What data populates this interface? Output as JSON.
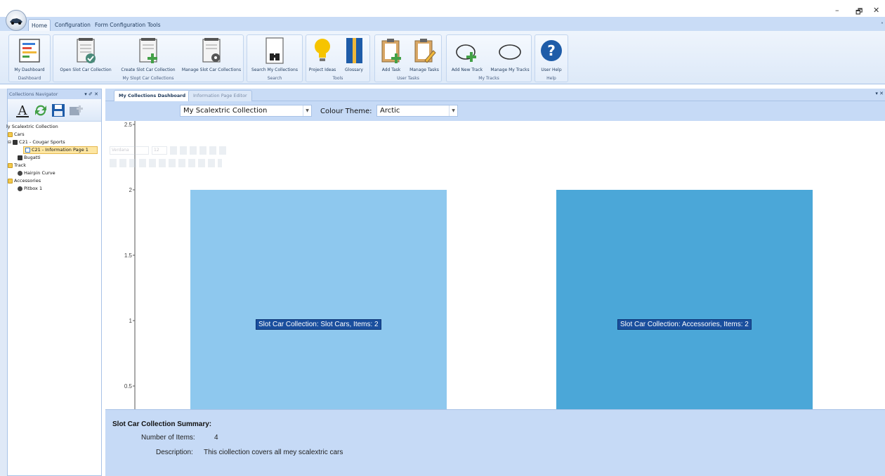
{
  "window": {
    "minimize": "–",
    "restore": "🗗",
    "close": "✕",
    "collapse": "˄"
  },
  "ribbon_tabs": [
    "Home",
    "Configuration",
    "Form Configuration",
    "Tools"
  ],
  "ribbon_groups": [
    {
      "label": "Dashboard",
      "buttons": [
        "My Dashboard"
      ]
    },
    {
      "label": "My Slopt Car Collections",
      "buttons": [
        "Open Slot Car Collection",
        "Create Slot Car Collection",
        "Manage Slot Car Collections"
      ]
    },
    {
      "label": "Search",
      "buttons": [
        "Search My Collections"
      ]
    },
    {
      "label": "Tools",
      "buttons": [
        "Project Ideas",
        "Glossary"
      ]
    },
    {
      "label": "User Tasks",
      "buttons": [
        "Add Task",
        "Manage Tasks"
      ]
    },
    {
      "label": "My Tracks",
      "buttons": [
        "Add New Track",
        "Manage My Tracks"
      ]
    },
    {
      "label": "Help",
      "buttons": [
        "User Help"
      ]
    }
  ],
  "navigator": {
    "title": "Collections Navigator",
    "pin": "▾ ✐ ✕",
    "items": [
      "ly Scalextric Collection",
      "Cars",
      "C21 - Cougar Sports",
      "C21 - Information Page 1",
      "Bugatti",
      "Track",
      "Hairpin Curve",
      "Accessories",
      "Pitbox 1"
    ]
  },
  "doc_tabs": [
    "My Collections Dashboard",
    "Information Page Editor"
  ],
  "doc_tabs_pin": "▾ ✕",
  "selector": {
    "collection": "My Scalextric Collection",
    "theme_label": "Colour Theme:",
    "theme": "Arctic"
  },
  "mini_toolbar": {
    "font": "Verdana",
    "size": "12"
  },
  "chart_data": {
    "type": "bar",
    "categories": [
      "Slot Cars",
      "Accessories"
    ],
    "values": [
      2,
      2
    ],
    "labels": [
      "Slot Car Collection: Slot Cars, Items: 2",
      "Slot Car Collection: Accessories, Items: 2"
    ],
    "yticks": [
      "0.5",
      "1",
      "1.5",
      "2",
      "2.5"
    ],
    "ylim": [
      0,
      2.5
    ],
    "colors": [
      "#8ec8ee",
      "#4ba7d8"
    ]
  },
  "summary": {
    "title": "Slot Car Collection Summary:",
    "items_label": "Number of Items:",
    "items_value": "4",
    "desc_label": "Description:",
    "desc_value": "This ciollection covers all mey scalextric cars"
  }
}
